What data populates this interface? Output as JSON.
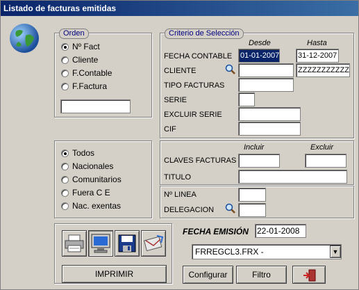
{
  "window": {
    "title": "Listado de facturas emitidas"
  },
  "orden": {
    "legend": "Orden",
    "options": [
      {
        "label": "Nº Fact",
        "selected": true
      },
      {
        "label": "Cliente",
        "selected": false
      },
      {
        "label": "F.Contable",
        "selected": false
      },
      {
        "label": "F.Factura",
        "selected": false
      }
    ],
    "input_value": ""
  },
  "tipo": {
    "options": [
      {
        "label": "Todos",
        "selected": true
      },
      {
        "label": "Nacionales",
        "selected": false
      },
      {
        "label": "Comunitarios",
        "selected": false
      },
      {
        "label": "Fuera C E",
        "selected": false
      },
      {
        "label": "Nac. exentas",
        "selected": false
      }
    ]
  },
  "criterio": {
    "legend": "Criterio de Selección",
    "desde_header": "Desde",
    "hasta_header": "Hasta",
    "fecha_contable_label": "FECHA CONTABLE",
    "fecha_desde": "01-01-2007",
    "fecha_hasta": "31-12-2007",
    "cliente_label": "CLIENTE",
    "cliente_desde": "",
    "cliente_hasta": "ZZZZZZZZZZZZ",
    "tipo_facturas_label": "TIPO FACTURAS",
    "serie_label": "SERIE",
    "excluir_serie_label": "EXCLUIR SERIE",
    "cif_label": "CIF"
  },
  "claves": {
    "incluir_header": "Incluir",
    "excluir_header": "Excluir",
    "claves_label": "CLAVES FACTURAS",
    "titulo_label": "TITULO"
  },
  "linea": {
    "n_linea_label": "Nº LINEA",
    "delegacion_label": "DELEGACION"
  },
  "output": {
    "imprimir_label": "IMPRIMIR",
    "fecha_emision_label": "FECHA EMISIÓN",
    "fecha_emision_value": "22-01-2008",
    "format_value": "FRREGCL3.FRX -",
    "configurar_label": "Configurar",
    "filtro_label": "Filtro"
  }
}
